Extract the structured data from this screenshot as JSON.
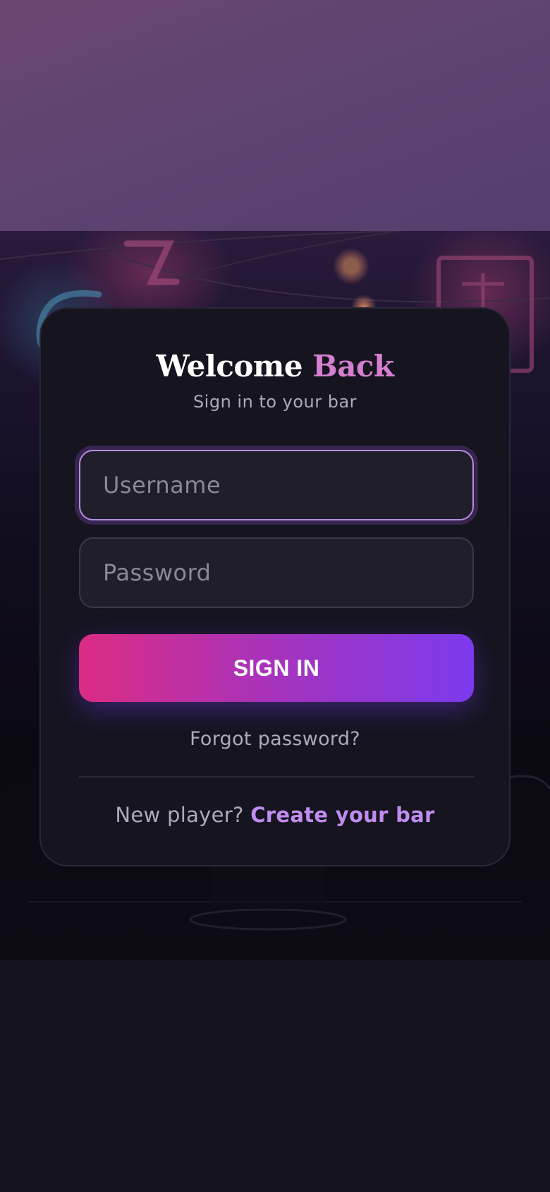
{
  "colors": {
    "background": "#12111c",
    "card": "#15141f",
    "accent_pink": "#d47fcf",
    "accent_purple": "#c08cf0",
    "button_gradient_start": "#dc2c84",
    "button_gradient_end": "#7c3aed"
  },
  "login": {
    "title_lead": "Welcome",
    "title_accent": "Back",
    "subtitle": "Sign in to your bar",
    "username_placeholder": "Username",
    "password_placeholder": "Password",
    "signin_label": "SIGN IN",
    "forgot_label": "Forgot password?",
    "signup_prompt": "New player?",
    "signup_link": "Create your bar"
  }
}
